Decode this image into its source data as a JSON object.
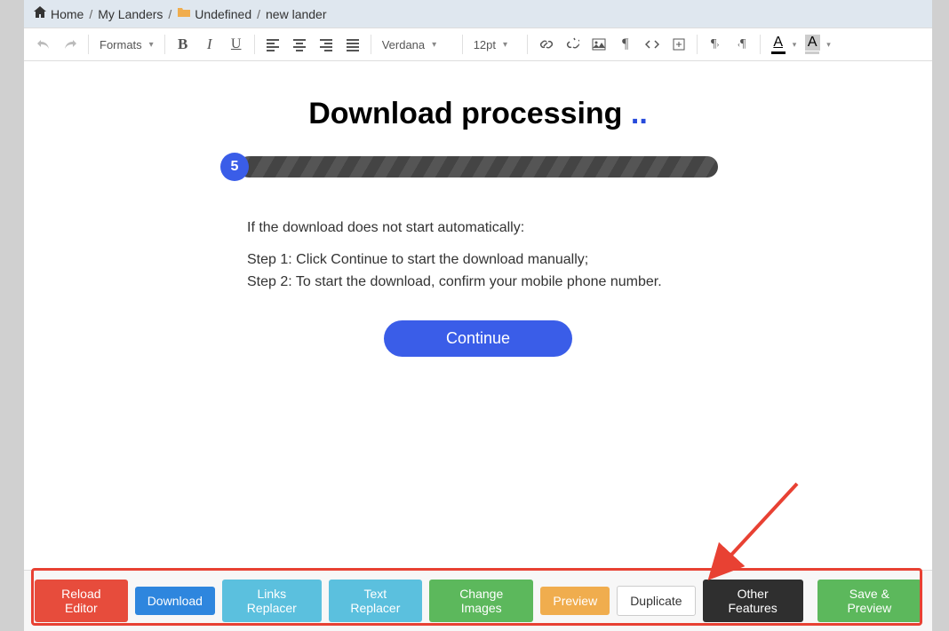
{
  "breadcrumb": {
    "home": "Home",
    "mylanders": "My Landers",
    "undefined": "Undefined",
    "newlander": "new lander"
  },
  "toolbar": {
    "formats": "Formats",
    "font": "Verdana",
    "size": "12pt"
  },
  "content": {
    "title_main": "Download processing ",
    "title_dots": "..",
    "progress_num": "5",
    "intro": "If the download does not start automatically:",
    "step1": "Step 1: Click Continue to start the download manually;",
    "step2": "Step 2: To start the download, confirm your mobile phone number.",
    "continue": "Continue"
  },
  "footer": {
    "reload": "Reload Editor",
    "download": "Download",
    "links": "Links Replacer",
    "text": "Text Replacer",
    "images": "Change Images",
    "preview": "Preview",
    "duplicate": "Duplicate",
    "other": "Other Features",
    "save": "Save & Preview"
  }
}
